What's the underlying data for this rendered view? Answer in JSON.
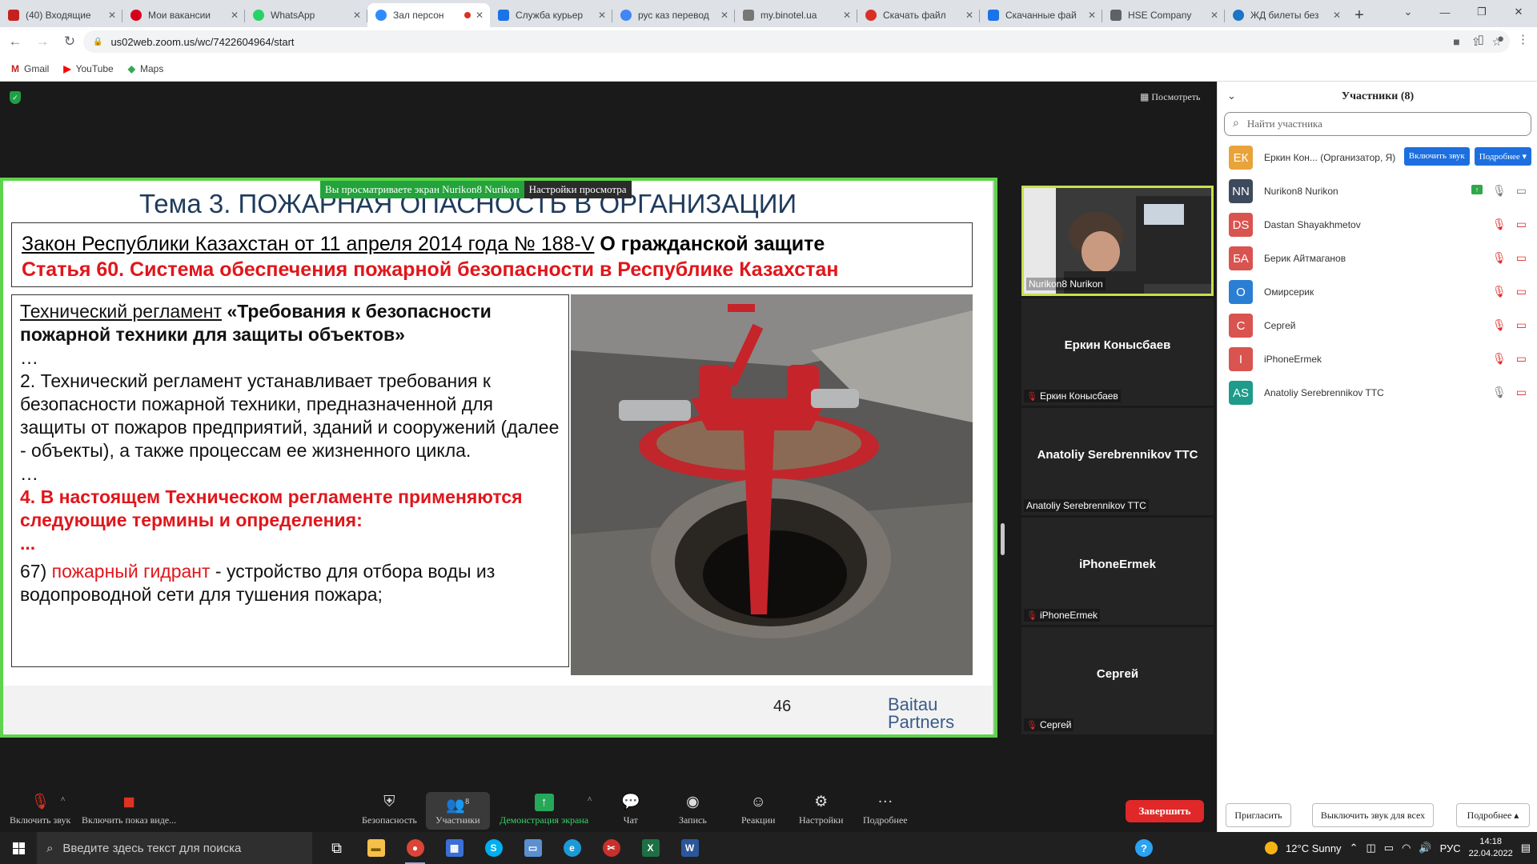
{
  "browser": {
    "tabs": [
      {
        "title": "(40) Входящие",
        "favicon": "gmail-icon",
        "color": "#c5221f"
      },
      {
        "title": "Мои вакансии",
        "favicon": "hh-icon",
        "color": "#d6001c"
      },
      {
        "title": "WhatsApp",
        "favicon": "whatsapp-icon",
        "color": "#25d366"
      },
      {
        "title": "Зал персон",
        "favicon": "zoom-icon",
        "color": "#2d8cff",
        "active": true
      },
      {
        "title": "Служба курьер",
        "favicon": "courier-icon",
        "color": "#1a73e8"
      },
      {
        "title": "рус каз перевод",
        "favicon": "google-icon",
        "color": "#4285f4"
      },
      {
        "title": "my.binotel.ua",
        "favicon": "binotel-icon",
        "color": "#777777"
      },
      {
        "title": "Скачать файл",
        "favicon": "heart-icon",
        "color": "#d93025"
      },
      {
        "title": "Скачанные фай",
        "favicon": "download-icon",
        "color": "#1a73e8"
      },
      {
        "title": "HSE Company",
        "favicon": "hse-icon",
        "color": "#5f6368"
      },
      {
        "title": "ЖД билеты без",
        "favicon": "train-icon",
        "color": "#1b74c5"
      }
    ],
    "url": "us02web.zoom.us/wc/7422604964/start",
    "bookmarks": [
      "Gmail",
      "YouTube",
      "Maps"
    ]
  },
  "meeting": {
    "view_option": "Посмотреть",
    "share_banner": {
      "viewing": "Вы просматриваете экран Nurikon8 Nurikon",
      "settings": "Настройки просмотра"
    }
  },
  "slide": {
    "title": "Тема 3. ПОЖАРНАЯ ОПАСНОСТЬ В ОРГАНИЗАЦИИ",
    "law_underlined": "Закон Республики Казахстан от 11 апреля 2014 года № 188-V",
    "law_bold": "О гражданской защите",
    "article": "Статья 60. Система обеспечения пожарной безопасности в Республике Казахстан",
    "reg_underlined": "Технический регламент",
    "reg_bold": "«Требования к безопасности пожарной техники для защиты объектов»",
    "ellipsis": "…",
    "para2": "2. Технический регламент устанавливает требования к безопасности пожарной техники, предназначенной для защиты от пожаров предприятий, зданий и сооружений (далее - объекты), а также процессам ее жизненного цикла.",
    "para4": "4. В настоящем Техническом регламенте применяются следующие термины и определения:",
    "red_ellipsis": "...",
    "item_num": "67)",
    "item_term": "пожарный гидрант",
    "item_def": " - устройство для отбора воды из водопроводной сети для тушения пожара;",
    "page": "46",
    "brand_line1": "Baitau",
    "brand_line2": "Partners"
  },
  "gallery": [
    {
      "big": "",
      "name": "Nurikon8 Nurikon",
      "muted": false,
      "video": true
    },
    {
      "big": "Еркин Конысбаев",
      "name": "Еркин Конысбаев",
      "muted": true
    },
    {
      "big": "Anatoliy Serebrennikov TTC",
      "name": "Anatoliy Serebrennikov TTC",
      "muted": false
    },
    {
      "big": "iPhoneErmek",
      "name": "iPhoneErmek",
      "muted": true
    },
    {
      "big": "Сергей",
      "name": "Сергей",
      "muted": true
    }
  ],
  "toolbar": {
    "unmute": "Включить звук",
    "video": "Включить показ виде...",
    "security": "Безопасность",
    "participants": "Участники",
    "participants_count": "8",
    "share": "Демонстрация экрана",
    "chat": "Чат",
    "record": "Запись",
    "reactions": "Реакции",
    "settings": "Настройки",
    "more": "Подробнее",
    "end": "Завершить"
  },
  "panel": {
    "title": "Участники (8)",
    "search_placeholder": "Найти участника",
    "host_unmute": "Включить звук",
    "host_more": "Подробнее ▾",
    "participants": [
      {
        "initials": "ЕК",
        "color": "#e8a33a",
        "name": "Еркин Кон...  (Организатор, Я)"
      },
      {
        "initials": "NN",
        "color": "#3d4a5c",
        "name": "Nurikon8 Nurikon"
      },
      {
        "initials": "DS",
        "color": "#d9534f",
        "name": "Dastan Shayakhmetov"
      },
      {
        "initials": "БА",
        "color": "#d9534f",
        "name": "Берик Айтмаганов"
      },
      {
        "initials": "О",
        "color": "#2a7fd4",
        "name": "Омирсерик"
      },
      {
        "initials": "С",
        "color": "#d9534f",
        "name": "Сергей"
      },
      {
        "initials": "I",
        "color": "#d9534f",
        "name": "iPhoneErmek"
      },
      {
        "initials": "AS",
        "color": "#1e9b8a",
        "name": "Anatoliy Serebrennikov TTC"
      }
    ],
    "invite": "Пригласить",
    "mute_all": "Выключить звук для всех",
    "more": "Подробнее ▴"
  },
  "taskbar": {
    "search_placeholder": "Введите здесь текст для поиска",
    "weather": "12°C  Sunny",
    "lang": "РУС",
    "time": "14:18",
    "date": "22.04.2022"
  }
}
